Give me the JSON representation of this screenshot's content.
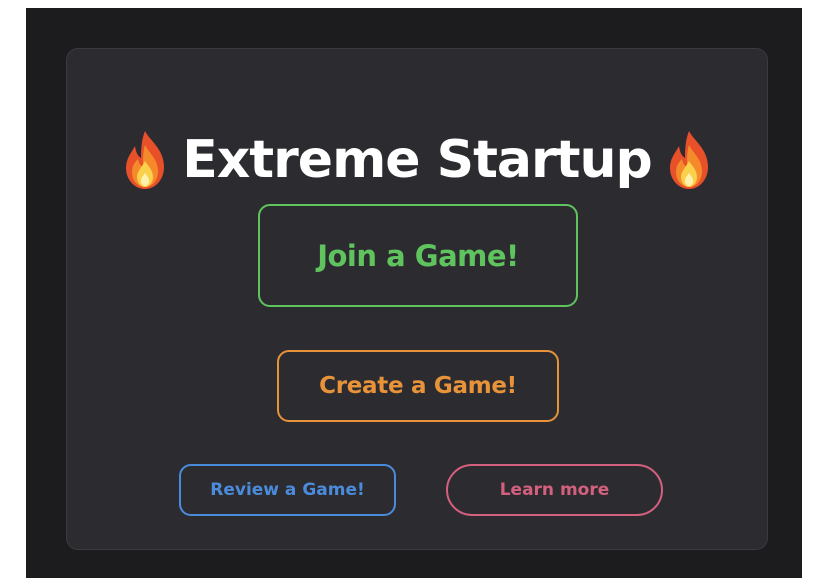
{
  "title": {
    "text": "Extreme Startup",
    "left_icon": "fire-icon",
    "right_icon": "fire-icon"
  },
  "buttons": {
    "join": "Join a Game!",
    "create": "Create a Game!",
    "review": "Review a Game!",
    "learn_more": "Learn more"
  },
  "colors": {
    "page_background": "#1c1c1f",
    "card_background": "#2c2c30",
    "title": "#ffffff",
    "join": "#5fc45d",
    "create": "#e8923a",
    "review": "#4b8bdb",
    "learn_more": "#d4607f"
  }
}
